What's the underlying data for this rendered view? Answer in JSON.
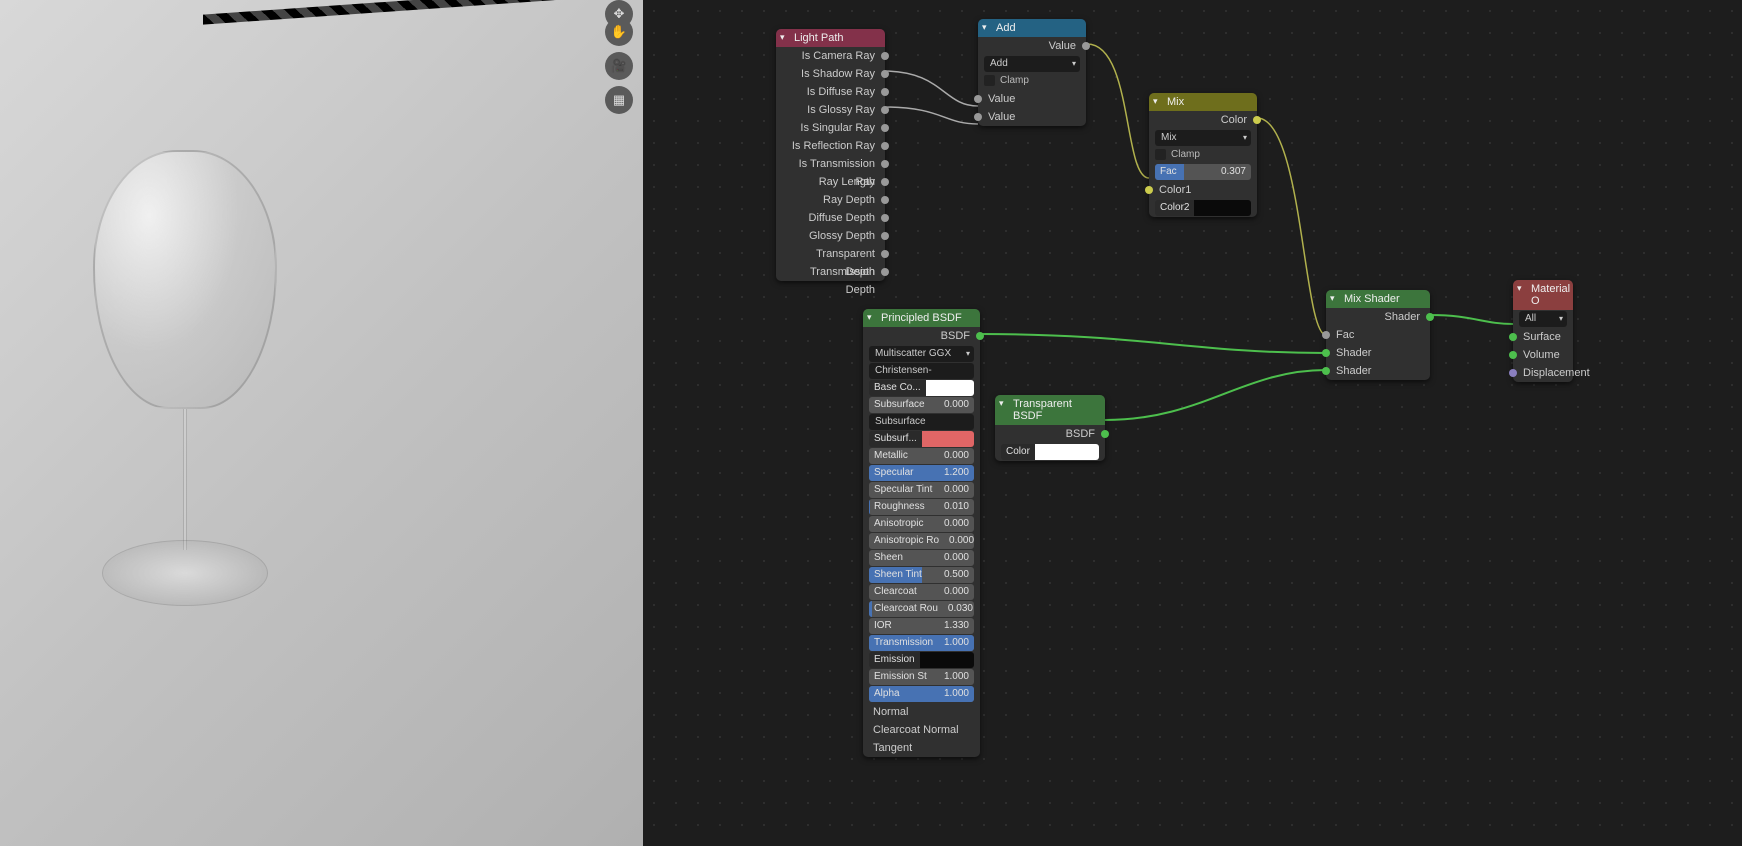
{
  "viewport_buttons": [
    "✥",
    "✋",
    "🎥",
    "▦"
  ],
  "light_path": {
    "title": "Light Path",
    "outs": [
      "Is Camera Ray",
      "Is Shadow Ray",
      "Is Diffuse Ray",
      "Is Glossy Ray",
      "Is Singular Ray",
      "Is Reflection Ray",
      "Is Transmission Ray",
      "Ray Length",
      "Ray Depth",
      "Diffuse Depth",
      "Glossy Depth",
      "Transparent Depth",
      "Transmission Depth"
    ]
  },
  "add": {
    "title": "Add",
    "out": "Value",
    "mode": "Add",
    "clamp": "Clamp",
    "in1": "Value",
    "in2": "Value"
  },
  "mix": {
    "title": "Mix",
    "out": "Color",
    "mode": "Mix",
    "clamp": "Clamp",
    "fac_label": "Fac",
    "fac_val": "0.307",
    "fac_fill": 30.7,
    "c1": "Color1",
    "c2": "Color2",
    "c2_sw": "#0a0a0a"
  },
  "principled": {
    "title": "Principled BSDF",
    "out": "BSDF",
    "dist": "Multiscatter GGX",
    "sss": "Christensen-Burley",
    "props": [
      {
        "k": "base",
        "label": "Base Co...",
        "color": "#ffffff",
        "sock": "yellow"
      },
      {
        "k": "subsurf",
        "label": "Subsurface",
        "val": "0.000",
        "fill": 0,
        "sock": "grey"
      },
      {
        "k": "ssrad",
        "label": "Subsurface Radius",
        "dd": true,
        "sock": "purple"
      },
      {
        "k": "ssubc",
        "label": "Subsurf...",
        "color": "#e06666",
        "sock": "yellow"
      },
      {
        "k": "metal",
        "label": "Metallic",
        "val": "0.000",
        "fill": 0,
        "sock": "grey"
      },
      {
        "k": "spec",
        "label": "Specular",
        "val": "1.200",
        "fill": 100,
        "sock": "grey"
      },
      {
        "k": "spect",
        "label": "Specular Tint",
        "val": "0.000",
        "fill": 0,
        "sock": "grey"
      },
      {
        "k": "rough",
        "label": "Roughness",
        "val": "0.010",
        "fill": 1,
        "sock": "grey"
      },
      {
        "k": "aniso",
        "label": "Anisotropic",
        "val": "0.000",
        "fill": 0,
        "sock": "grey"
      },
      {
        "k": "anisor",
        "label": "Anisotropic Ro",
        "val": "0.000",
        "fill": 0,
        "sock": "grey"
      },
      {
        "k": "sheen",
        "label": "Sheen",
        "val": "0.000",
        "fill": 0,
        "sock": "grey"
      },
      {
        "k": "sheent",
        "label": "Sheen Tint",
        "val": "0.500",
        "fill": 50,
        "sock": "grey"
      },
      {
        "k": "cc",
        "label": "Clearcoat",
        "val": "0.000",
        "fill": 0,
        "sock": "grey"
      },
      {
        "k": "ccr",
        "label": "Clearcoat Rou",
        "val": "0.030",
        "fill": 3,
        "sock": "grey"
      },
      {
        "k": "ior",
        "label": "IOR",
        "val": "1.330",
        "plain": true,
        "sock": "grey"
      },
      {
        "k": "trans",
        "label": "Transmission",
        "val": "1.000",
        "fill": 100,
        "sock": "grey"
      },
      {
        "k": "emis",
        "label": "Emission",
        "color": "#0a0a0a",
        "sock": "yellow"
      },
      {
        "k": "emiss",
        "label": "Emission St",
        "val": "1.000",
        "plain": true,
        "sock": "grey"
      },
      {
        "k": "alpha",
        "label": "Alpha",
        "val": "1.000",
        "fill": 100,
        "sock": "grey"
      },
      {
        "k": "nrm",
        "label": "Normal",
        "text": true,
        "sock": "purple"
      },
      {
        "k": "ccn",
        "label": "Clearcoat Normal",
        "text": true,
        "sock": "purple"
      },
      {
        "k": "tan",
        "label": "Tangent",
        "text": true,
        "sock": "purple"
      }
    ]
  },
  "transparent": {
    "title": "Transparent BSDF",
    "out": "BSDF",
    "in": "Color",
    "swatch": "#ffffff"
  },
  "mixshader": {
    "title": "Mix Shader",
    "out": "Shader",
    "fac": "Fac",
    "s1": "Shader",
    "s2": "Shader"
  },
  "matout": {
    "title": "Material O",
    "target": "All",
    "surface": "Surface",
    "volume": "Volume",
    "disp": "Displacement"
  }
}
